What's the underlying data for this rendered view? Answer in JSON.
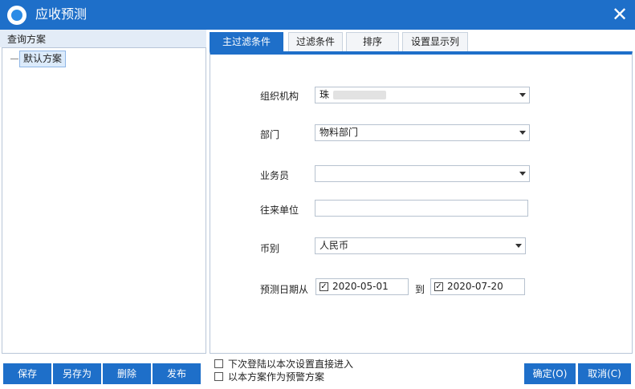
{
  "window": {
    "title": "应收预测",
    "close_symbol": "✕"
  },
  "left": {
    "header": "查询方案",
    "tree_items": [
      "默认方案"
    ]
  },
  "tabs": [
    {
      "label": "主过滤条件",
      "active": true
    },
    {
      "label": "过滤条件",
      "active": false
    },
    {
      "label": "排序",
      "active": false
    },
    {
      "label": "设置显示列",
      "active": false
    }
  ],
  "form": {
    "org": {
      "label": "组织机构",
      "value": "珠"
    },
    "dept": {
      "label": "部门",
      "value": "物料部门"
    },
    "salesman": {
      "label": "业务员",
      "value": ""
    },
    "partner": {
      "label": "往来单位",
      "value": ""
    },
    "currency": {
      "label": "币别",
      "value": "人民币"
    },
    "forecast_date": {
      "label": "预测日期从",
      "from": "2020-05-01",
      "to_label": "到",
      "to": "2020-07-20",
      "check": "✓"
    }
  },
  "footer": {
    "buttons_left": [
      "保存",
      "另存为",
      "删除",
      "发布"
    ],
    "options": [
      "下次登陆以本次设置直接进入",
      "以本方案作为预警方案"
    ],
    "ok": "确定(O)",
    "cancel": "取消(C)"
  },
  "colors": {
    "accent": "#1e6fc9",
    "panel_header": "#e3ecf7"
  }
}
